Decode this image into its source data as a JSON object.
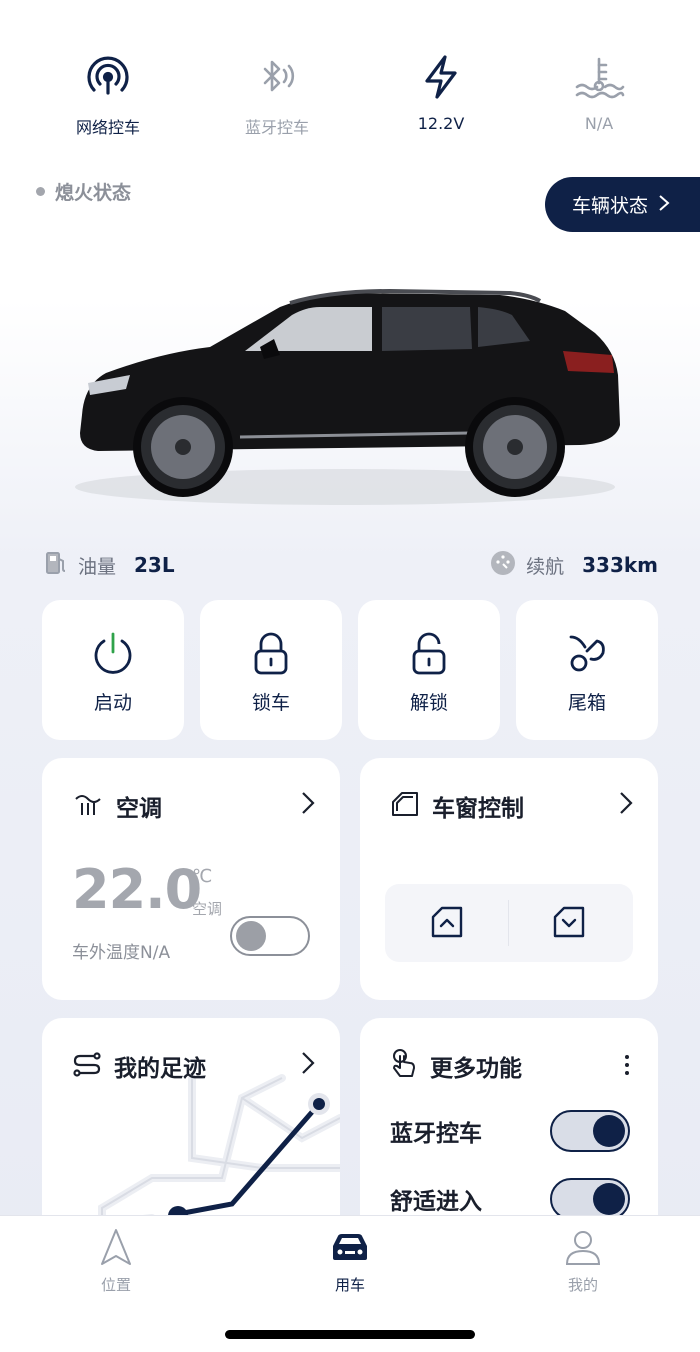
{
  "status_bar": {
    "items": [
      {
        "label": "网络控车",
        "icon": "network-signal-icon",
        "active": true
      },
      {
        "label": "蓝牙控车",
        "icon": "bluetooth-icon",
        "active": false
      },
      {
        "label": "12.2V",
        "icon": "lightning-icon",
        "active": true
      },
      {
        "label": "N/A",
        "icon": "coolant-temperature-icon",
        "active": false
      }
    ]
  },
  "engine_status": "熄火状态",
  "vehicle_status_button": "车辆状态",
  "stats": {
    "fuel_label": "油量",
    "fuel_value": "23L",
    "range_label": "续航",
    "range_value": "333km"
  },
  "quick_actions": [
    {
      "label": "启动",
      "icon": "power-icon"
    },
    {
      "label": "锁车",
      "icon": "lock-icon"
    },
    {
      "label": "解锁",
      "icon": "unlock-icon"
    },
    {
      "label": "尾箱",
      "icon": "trunk-icon"
    }
  ],
  "ac_card": {
    "title": "空调",
    "temperature": "22.0",
    "unit": "℃",
    "unit_sub": "空调",
    "outside_temp": "车外温度N/A",
    "enabled": false
  },
  "window_card": {
    "title": "车窗控制"
  },
  "track_card": {
    "title": "我的足迹"
  },
  "more_card": {
    "title": "更多功能",
    "rows": [
      {
        "label": "蓝牙控车",
        "enabled": true
      },
      {
        "label": "舒适进入",
        "enabled": true
      }
    ]
  },
  "tabbar": {
    "items": [
      {
        "label": "位置",
        "active": false
      },
      {
        "label": "用车",
        "active": true
      },
      {
        "label": "我的",
        "active": false
      }
    ]
  },
  "colors": {
    "brand": "#0f2147",
    "inactive": "#9aa0ab",
    "power_accent": "#2fa24a"
  }
}
